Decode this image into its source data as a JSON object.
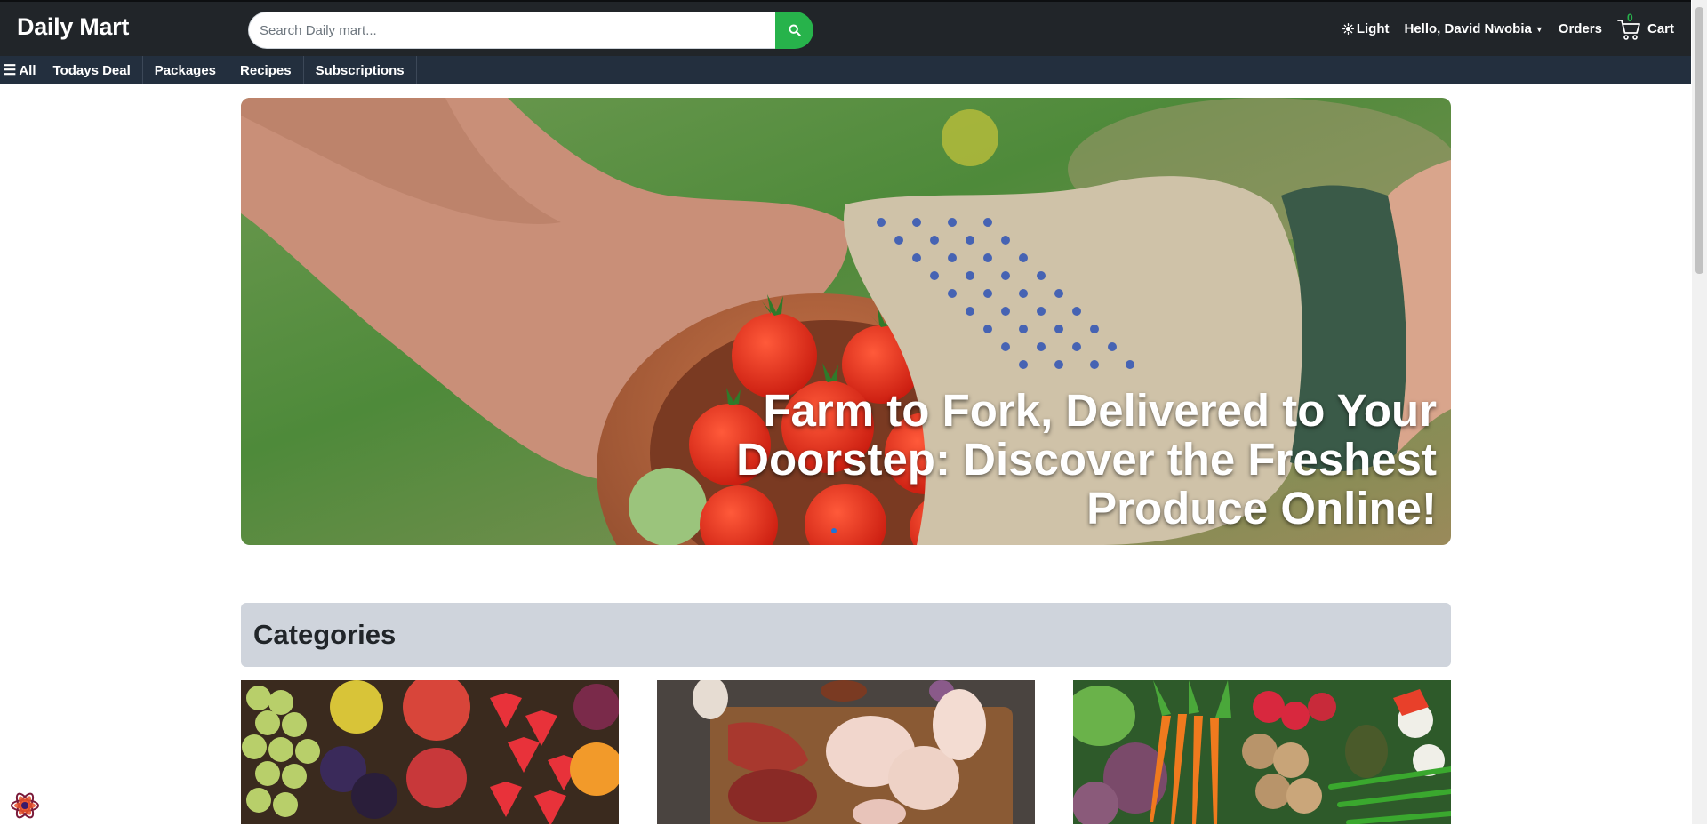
{
  "brand": {
    "name": "Daily Mart"
  },
  "search": {
    "placeholder": "Search Daily mart..."
  },
  "header": {
    "theme_label": "Light",
    "greeting": "Hello, David Nwobia",
    "orders_label": "Orders",
    "cart_label": "Cart",
    "cart_count": "0"
  },
  "nav": {
    "all_label": "All",
    "items": [
      {
        "label": "Todays Deal"
      },
      {
        "label": "Packages"
      },
      {
        "label": "Recipes"
      },
      {
        "label": "Subscriptions"
      }
    ]
  },
  "hero": {
    "caption": "Farm to Fork, Delivered to Your Doorstep: Discover the Freshest Produce Online!"
  },
  "categories": {
    "title": "Categories",
    "cards": [
      {
        "name": "fruits"
      },
      {
        "name": "meat"
      },
      {
        "name": "vegetables"
      }
    ]
  },
  "colors": {
    "topbar": "#212529",
    "navbar": "#232f3e",
    "accent": "#27b34b",
    "category_header": "#cfd4dc"
  },
  "icons": {
    "search": "search-icon",
    "theme": "sun-icon",
    "cart": "cart-icon",
    "menu": "hamburger-icon",
    "caret": "caret-down-icon",
    "devtools": "react-logo-icon"
  }
}
